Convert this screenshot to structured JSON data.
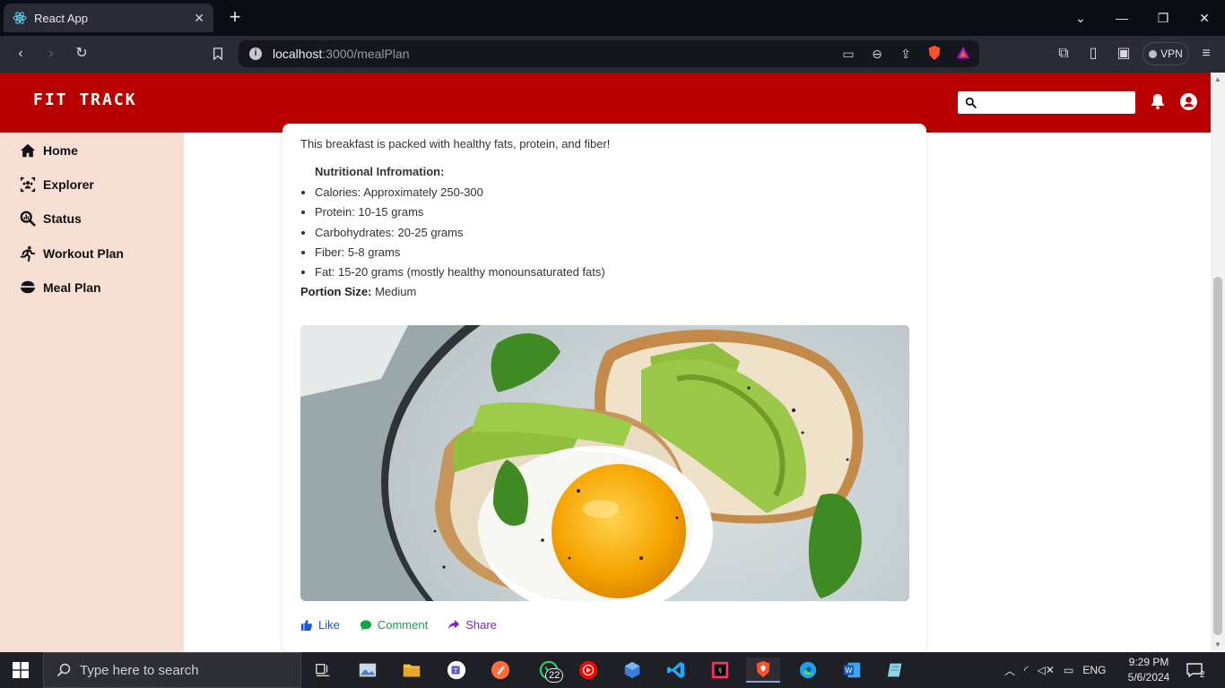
{
  "browser": {
    "tab_title": "React App",
    "url_host": "localhost",
    "url_rest": ":3000/mealPlan",
    "vpn_label": "VPN"
  },
  "app": {
    "brand": "FIT TRACK",
    "search_placeholder": ""
  },
  "sidebar": {
    "items": [
      {
        "label": "Home",
        "icon": "home-icon"
      },
      {
        "label": "Explorer",
        "icon": "users-icon"
      },
      {
        "label": "Status",
        "icon": "search-chart-icon"
      },
      {
        "label": "Workout Plan",
        "icon": "running-icon"
      },
      {
        "label": "Meal Plan",
        "icon": "bowl-icon"
      }
    ]
  },
  "post": {
    "description": "This breakfast is packed with healthy fats, protein, and fiber!",
    "nutrition_title": "Nutritional Infromation:",
    "nutrition": [
      "Calories: Approximately 250-300",
      "Protein: 10-15 grams",
      "Carbohydrates: 20-25 grams",
      "Fiber: 5-8 grams",
      "Fat: 15-20 grams (mostly healthy monounsaturated fats)"
    ],
    "portion_label": "Portion Size:",
    "portion_value": "Medium",
    "actions": {
      "like": "Like",
      "comment": "Comment",
      "share": "Share"
    },
    "colors": {
      "like": "#1a56db",
      "comment": "#16a34a",
      "share": "#7e22ce"
    }
  },
  "taskbar": {
    "search_placeholder": "Type here to search",
    "whatsapp_badge": "22",
    "language": "ENG",
    "time": "9:29 PM",
    "date": "5/6/2024",
    "notification_count": "2"
  },
  "theme": {
    "header_red": "#b80000",
    "sidebar_bg": "#f8dfd4"
  }
}
